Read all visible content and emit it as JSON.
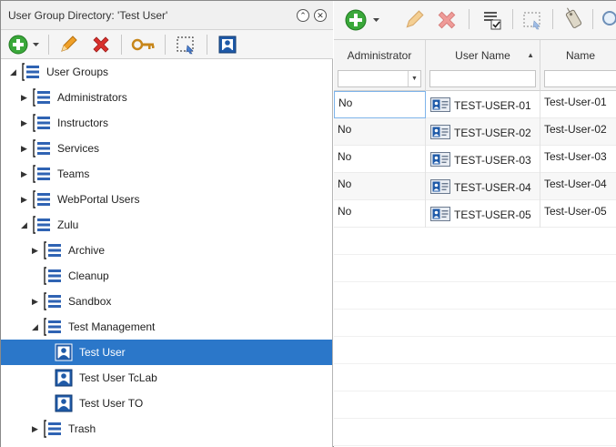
{
  "left_panel": {
    "title": "User Group Directory: 'Test User'",
    "title_buttons": [
      "⌃",
      "✕"
    ],
    "toolbar": [
      {
        "name": "add-button",
        "icon": "plus-circle-icon"
      },
      {
        "name": "edit-button",
        "icon": "pencil-icon"
      },
      {
        "name": "delete-button",
        "icon": "red-x-icon"
      },
      {
        "name": "key-button",
        "icon": "key-icon"
      },
      {
        "name": "select-button",
        "icon": "selection-icon"
      },
      {
        "name": "user-card-button",
        "icon": "user-card-icon"
      }
    ],
    "tree": [
      {
        "label": "User Groups",
        "type": "group",
        "level": 0,
        "expanded": true
      },
      {
        "label": "Administrators",
        "type": "group",
        "level": 1,
        "expanded": false
      },
      {
        "label": "Instructors",
        "type": "group",
        "level": 1,
        "expanded": false
      },
      {
        "label": "Services",
        "type": "group",
        "level": 1,
        "expanded": false
      },
      {
        "label": "Teams",
        "type": "group",
        "level": 1,
        "expanded": false
      },
      {
        "label": "WebPortal Users",
        "type": "group",
        "level": 1,
        "expanded": false
      },
      {
        "label": "Zulu",
        "type": "group",
        "level": 1,
        "expanded": true
      },
      {
        "label": "Archive",
        "type": "group",
        "level": 2,
        "expanded": false
      },
      {
        "label": "Cleanup",
        "type": "group",
        "level": 2,
        "expanded": null
      },
      {
        "label": "Sandbox",
        "type": "group",
        "level": 2,
        "expanded": false
      },
      {
        "label": "Test Management",
        "type": "group",
        "level": 2,
        "expanded": true
      },
      {
        "label": "Test User",
        "type": "user",
        "level": 3,
        "selected": true
      },
      {
        "label": "Test User TcLab",
        "type": "user",
        "level": 3
      },
      {
        "label": "Test User TO",
        "type": "user",
        "level": 3
      },
      {
        "label": "Trash",
        "type": "group",
        "level": 2,
        "expanded": false
      }
    ]
  },
  "right_panel": {
    "toolbar": [
      {
        "name": "add-button",
        "icon": "plus-circle-icon"
      },
      {
        "name": "edit-button",
        "icon": "pencil-icon-disabled"
      },
      {
        "name": "delete-button",
        "icon": "red-x-icon-disabled"
      },
      {
        "name": "checklist-button",
        "icon": "checklist-icon"
      },
      {
        "name": "select-button",
        "icon": "selection-icon"
      },
      {
        "name": "tag-button",
        "icon": "tag-icon"
      },
      {
        "name": "search-button",
        "icon": "magnifier-icon"
      }
    ],
    "columns": [
      {
        "label": "Administrator",
        "filter": "",
        "sorted": false
      },
      {
        "label": "User Name",
        "filter": "",
        "sorted": true
      },
      {
        "label": "Name",
        "filter": "",
        "sorted": false
      }
    ],
    "rows": [
      {
        "admin": "No",
        "username": "TEST-USER-01",
        "name": "Test-User-01"
      },
      {
        "admin": "No",
        "username": "TEST-USER-02",
        "name": "Test-User-02"
      },
      {
        "admin": "No",
        "username": "TEST-USER-03",
        "name": "Test-User-03"
      },
      {
        "admin": "No",
        "username": "TEST-USER-04",
        "name": "Test-User-04"
      },
      {
        "admin": "No",
        "username": "TEST-USER-05",
        "name": "Test-User-05"
      }
    ]
  },
  "colors": {
    "selection": "#2b77c9",
    "add_green": "#3aa83a",
    "delete_red": "#d9302c",
    "edit_orange": "#f0a028",
    "group_blue": "#2f63b3"
  }
}
